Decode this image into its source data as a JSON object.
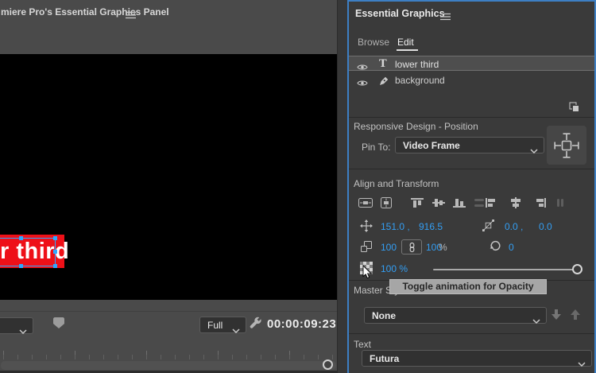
{
  "window": {
    "tab_title": "miere Pro's Essential Graphics Panel"
  },
  "canvas": {
    "text": "r third"
  },
  "monitor_controls": {
    "quality": "Full",
    "timecode": "00:00:09:23"
  },
  "panel": {
    "title": "Essential Graphics",
    "tabs": {
      "browse": "Browse",
      "edit": "Edit"
    },
    "layers": [
      {
        "name": "lower third",
        "glyph": "T"
      },
      {
        "name": "background"
      }
    ],
    "responsive": {
      "heading": "Responsive Design - Position",
      "pin_label": "Pin To:",
      "pin_value": "Video Frame"
    },
    "align_heading": "Align and Transform",
    "transform": {
      "position_x": "151.0 ,",
      "position_y": "916.5",
      "anchor_x": "0.0 ,",
      "anchor_y": "0.0",
      "scale_x": "100",
      "scale_y": "100",
      "scale_unit": "%",
      "rotation": "0",
      "opacity": "100 %"
    },
    "tooltip": "Toggle animation for Opacity",
    "master": {
      "heading": "Master Styles",
      "value": "None"
    },
    "text_section": {
      "heading": "Text",
      "value": "Futura"
    }
  },
  "colors": {
    "accent_blue": "#339ef3",
    "selection_blue": "#2da8ff",
    "title_red": "#ee1018",
    "panel_focus_border": "#3d7fc4"
  }
}
